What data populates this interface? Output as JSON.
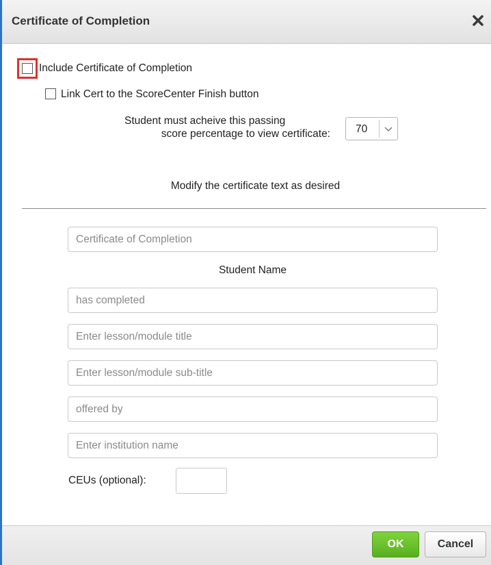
{
  "dialog": {
    "title": "Certificate of Completion",
    "close_icon": "close-icon"
  },
  "options": {
    "include_label": "Include Certificate of Completion",
    "include_checked": false,
    "link_label": "Link Cert to the ScoreCenter Finish button",
    "link_checked": false,
    "passing_line1": "Student must acheive this passing",
    "passing_line2": "score percentage to view certificate:",
    "passing_value": "70",
    "dropdown_icon": "chevron-down-icon"
  },
  "certificate": {
    "modify_text": "Modify the certificate text as desired",
    "title_placeholder": "Certificate of Completion",
    "student_name": "Student Name",
    "completed_placeholder": "has completed",
    "lesson_title_placeholder": "Enter lesson/module title",
    "lesson_subtitle_placeholder": "Enter lesson/module sub-title",
    "offered_by_placeholder": "offered by",
    "institution_placeholder": "Enter institution name",
    "ceus_label": "CEUs (optional):",
    "ceus_value": ""
  },
  "footer": {
    "ok_label": "OK",
    "cancel_label": "Cancel"
  },
  "colors": {
    "accent_border": "#2a74c9",
    "highlight": "#e0302b",
    "ok_green": "#5aaf1f"
  }
}
